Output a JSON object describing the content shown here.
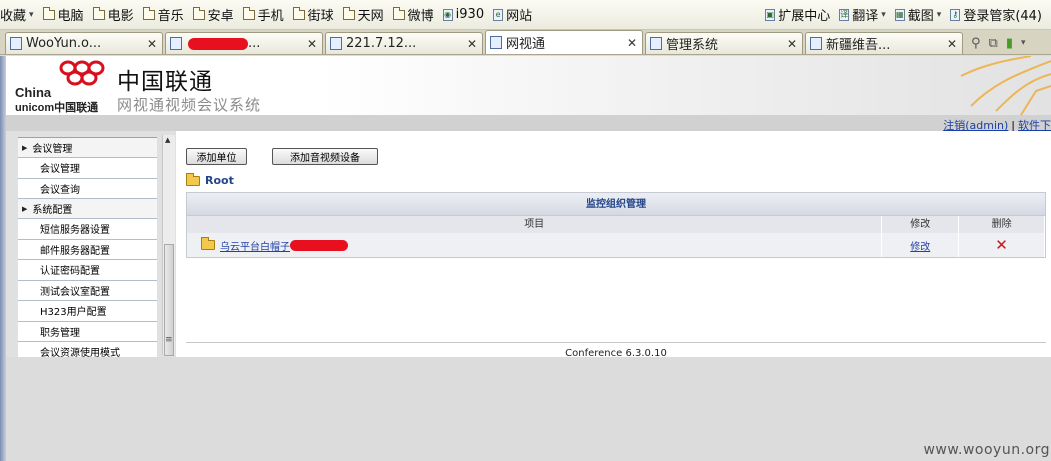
{
  "bookmarks": {
    "favorites_label": "收藏",
    "items": [
      {
        "label": "电脑",
        "icon": "folder-icon"
      },
      {
        "label": "电影",
        "icon": "folder-icon"
      },
      {
        "label": "音乐",
        "icon": "folder-icon"
      },
      {
        "label": "安卓",
        "icon": "folder-icon"
      },
      {
        "label": "手机",
        "icon": "folder-icon"
      },
      {
        "label": "街球",
        "icon": "folder-icon"
      },
      {
        "label": "天网",
        "icon": "folder-icon"
      },
      {
        "label": "微博",
        "icon": "folder-icon"
      },
      {
        "label": "i930",
        "icon": "page-icon"
      },
      {
        "label": "网站",
        "icon": "page-icon"
      }
    ],
    "tools": [
      {
        "label": "扩展中心"
      },
      {
        "label": "翻译"
      },
      {
        "label": "截图"
      },
      {
        "label": "登录管家(44)"
      }
    ]
  },
  "tabs": [
    {
      "label": "WooYun.o..."
    },
    {
      "label": "..."
    },
    {
      "label": "221.7.12..."
    },
    {
      "label": "网视通"
    },
    {
      "label": "管理系统"
    },
    {
      "label": "新疆维吾..."
    }
  ],
  "header": {
    "brand_en_1": "China",
    "brand_en_2": "unicom中国联通",
    "brand_cn": "中国联通",
    "system_name": "网视通视频会议系统"
  },
  "toplinks": {
    "logout": "注销(admin)",
    "separator": "|",
    "download": "软件下"
  },
  "sidebar": {
    "groups": [
      {
        "label": "会议管理",
        "items": [
          {
            "label": "会议管理"
          },
          {
            "label": "会议查询"
          }
        ]
      },
      {
        "label": "系统配置",
        "items": [
          {
            "label": "短信服务器设置"
          },
          {
            "label": "邮件服务器配置"
          },
          {
            "label": "认证密码配置"
          },
          {
            "label": "测试会议室配置"
          },
          {
            "label": "H323用户配置"
          },
          {
            "label": "职务管理"
          },
          {
            "label": "会议资源使用模式"
          }
        ]
      }
    ]
  },
  "main": {
    "add_unit_button": "添加单位",
    "add_device_button": "添加音视频设备",
    "root_label": "Root",
    "table": {
      "title": "监控组织管理",
      "headers": [
        "项目",
        "修改",
        "删除"
      ],
      "rows": [
        {
          "name": "乌云平台白帽子",
          "edit": "修改",
          "delete": "✕"
        }
      ]
    },
    "footer": "Conference 6.3.0.10"
  },
  "watermark": "www.wooyun.org",
  "colors": {
    "link": "#2342a8",
    "table_title": "#24448a",
    "delete_icon": "#c51a1a",
    "redaction": "#e8101e"
  }
}
